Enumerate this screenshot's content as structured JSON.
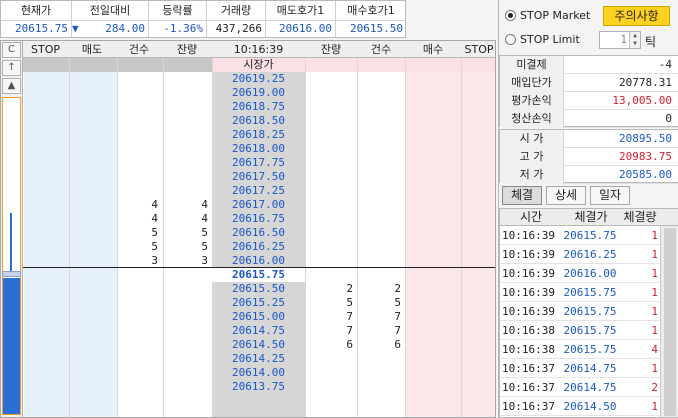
{
  "quote": {
    "headers": [
      "현재가",
      "전일대비",
      "등락률",
      "거래량",
      "매도호가1",
      "매수호가1"
    ],
    "current": "20615.75",
    "change_arrow": "▼",
    "change": "284.00",
    "rate": "-1.36%",
    "volume": "437,266",
    "ask1": "20616.00",
    "bid1": "20615.50"
  },
  "grid": {
    "side_buttons": [
      "C",
      "↑",
      "▲"
    ],
    "headers": [
      "STOP",
      "매도",
      "건수",
      "잔량",
      "10:16:39",
      "잔량",
      "건수",
      "매수",
      "STOP"
    ],
    "market_label": "시장가",
    "current_price": "20615.75",
    "sell_rows": [
      {
        "price": "20619.25",
        "count": "",
        "qty": ""
      },
      {
        "price": "20619.00",
        "count": "",
        "qty": ""
      },
      {
        "price": "20618.75",
        "count": "",
        "qty": ""
      },
      {
        "price": "20618.50",
        "count": "",
        "qty": ""
      },
      {
        "price": "20618.25",
        "count": "",
        "qty": ""
      },
      {
        "price": "20618.00",
        "count": "",
        "qty": ""
      },
      {
        "price": "20617.75",
        "count": "",
        "qty": ""
      },
      {
        "price": "20617.50",
        "count": "",
        "qty": ""
      },
      {
        "price": "20617.25",
        "count": "",
        "qty": ""
      },
      {
        "price": "20617.00",
        "count": "4",
        "qty": "4"
      },
      {
        "price": "20616.75",
        "count": "4",
        "qty": "4"
      },
      {
        "price": "20616.50",
        "count": "5",
        "qty": "5"
      },
      {
        "price": "20616.25",
        "count": "5",
        "qty": "5"
      },
      {
        "price": "20616.00",
        "count": "3",
        "qty": "3"
      }
    ],
    "buy_rows": [
      {
        "price": "20615.50",
        "qty": "2",
        "count": "2"
      },
      {
        "price": "20615.25",
        "qty": "5",
        "count": "5"
      },
      {
        "price": "20615.00",
        "qty": "7",
        "count": "7"
      },
      {
        "price": "20614.75",
        "qty": "7",
        "count": "7"
      },
      {
        "price": "20614.50",
        "qty": "6",
        "count": "6"
      },
      {
        "price": "20614.25",
        "qty": "",
        "count": ""
      },
      {
        "price": "20614.00",
        "qty": "",
        "count": ""
      },
      {
        "price": "20613.75",
        "qty": "",
        "count": ""
      }
    ]
  },
  "panel": {
    "stop_market": "STOP Market",
    "stop_limit": "STOP Limit",
    "warning_button": "주의사항",
    "tick_value": "1",
    "tick_label": "틱",
    "position": [
      {
        "label": "미결제",
        "value": "-4",
        "color": "#222222"
      },
      {
        "label": "매입단가",
        "value": "20778.31",
        "color": "#222222"
      },
      {
        "label": "평가손익",
        "value": "13,005.00",
        "color": "#d0202a"
      },
      {
        "label": "청산손익",
        "value": "0",
        "color": "#222222"
      }
    ],
    "prices": [
      {
        "label": "시 가",
        "value": "20895.50",
        "color": "#1a57c8"
      },
      {
        "label": "고 가",
        "value": "20983.75",
        "color": "#d0202a"
      },
      {
        "label": "저 가",
        "value": "20585.00",
        "color": "#1a57c8"
      }
    ],
    "tabs": [
      "체결",
      "상세",
      "일자"
    ],
    "trade_headers": [
      "시간",
      "체결가",
      "체결량"
    ],
    "trades": [
      {
        "time": "10:16:39",
        "price": "20615.75",
        "qty": "1"
      },
      {
        "time": "10:16:39",
        "price": "20616.25",
        "qty": "1"
      },
      {
        "time": "10:16:39",
        "price": "20616.00",
        "qty": "1"
      },
      {
        "time": "10:16:39",
        "price": "20615.75",
        "qty": "1"
      },
      {
        "time": "10:16:39",
        "price": "20615.75",
        "qty": "1"
      },
      {
        "time": "10:16:38",
        "price": "20615.75",
        "qty": "1"
      },
      {
        "time": "10:16:38",
        "price": "20615.75",
        "qty": "4"
      },
      {
        "time": "10:16:37",
        "price": "20614.75",
        "qty": "1"
      },
      {
        "time": "10:16:37",
        "price": "20614.75",
        "qty": "2"
      },
      {
        "time": "10:16:37",
        "price": "20614.50",
        "qty": "1"
      }
    ]
  },
  "colors": {
    "blue": "#1a57c8",
    "red": "#d0202a",
    "sell_bg": "#e6f0fb",
    "buy_bg": "#fbe6ea",
    "price_bg": "#d6d6d6",
    "accent": "#ffd21f"
  }
}
